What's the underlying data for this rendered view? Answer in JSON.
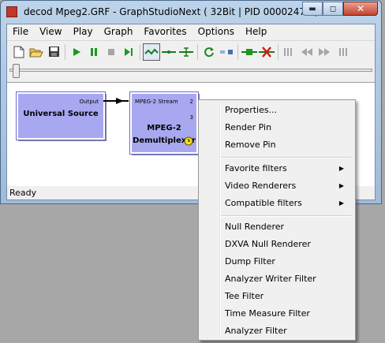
{
  "window": {
    "title": "decod Mpeg2.GRF - GraphStudioNext ( 32Bit | PID 00002470 )"
  },
  "menubar": [
    "File",
    "View",
    "Play",
    "Graph",
    "Favorites",
    "Options",
    "Help"
  ],
  "toolbar": {
    "buttons": [
      "new-file",
      "open-file",
      "save",
      "play",
      "pause",
      "stop",
      "step",
      "connect-mode",
      "line",
      "split",
      "refresh",
      "disconnect",
      "insert-filter",
      "delete-filter",
      "prev-frame",
      "rewind",
      "fast-forward",
      "next-frame"
    ]
  },
  "graph": {
    "source": {
      "name": "Universal Source",
      "pin_out": "Output"
    },
    "demux": {
      "name_line1": "MPEG-2",
      "name_line2": "Demultiplexer",
      "pin_in": "MPEG-2 Stream",
      "pin_out_1": "2",
      "pin_out_2": "3"
    }
  },
  "status": "Ready",
  "context_menu": {
    "group1": [
      "Properties...",
      "Render Pin",
      "Remove Pin"
    ],
    "group2": [
      "Favorite filters",
      "Video Renderers",
      "Compatible filters"
    ],
    "group3": [
      "Null Renderer",
      "DXVA Null Renderer",
      "Dump Filter",
      "Analyzer Writer Filter",
      "Tee Filter",
      "Time Measure Filter",
      "Analyzer Filter"
    ]
  },
  "colors": {
    "filter_fill": "#a8a8f0",
    "title_bg": "#bcd3ea",
    "close_button": "#c4432d"
  }
}
